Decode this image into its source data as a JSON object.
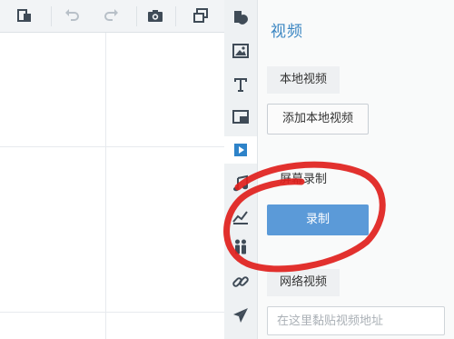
{
  "panel": {
    "title": "视频",
    "local_section_label": "本地视频",
    "add_local_button": "添加本地视频",
    "record_section_label": "屏幕录制",
    "record_button": "录制",
    "network_section_label": "网络视频",
    "url_placeholder": "在这里黏贴视频地址"
  },
  "toolbar": {
    "icons": [
      "paste-icon",
      "undo-icon",
      "redo-icon",
      "camera-icon",
      "window-icon"
    ]
  },
  "icon_strip": {
    "items": [
      "shape-icon",
      "image-icon",
      "text-icon",
      "frame-icon",
      "video-icon",
      "music-icon",
      "chart-icon",
      "people-icon",
      "link-icon",
      "airplane-icon"
    ],
    "active": "video-icon"
  },
  "colors": {
    "accent": "#3b86c2",
    "primary_button": "#5b9ad8",
    "annotation_red": "#e0201c"
  }
}
